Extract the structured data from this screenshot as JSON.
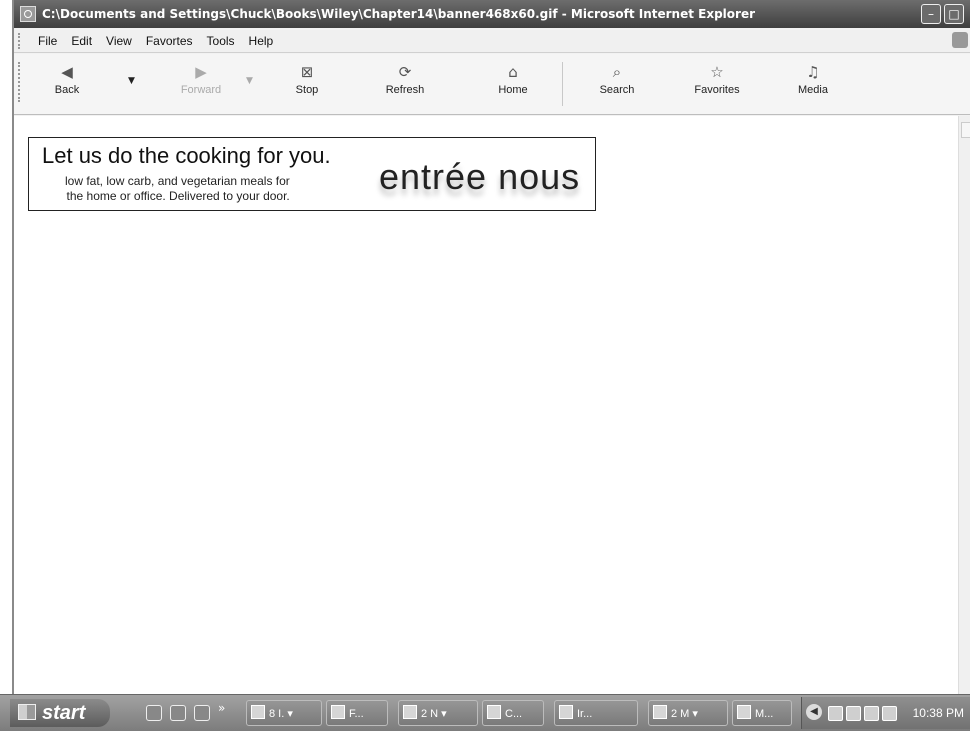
{
  "window": {
    "title": "C:\\Documents and Settings\\Chuck\\Books\\Wiley\\Chapter14\\banner468x60.gif - Microsoft Internet Explorer"
  },
  "menu": [
    "File",
    "Edit",
    "View",
    "Favortes",
    "Tools",
    "Help"
  ],
  "toolbar": {
    "back": "Back",
    "forward": "Forward",
    "stop": "Stop",
    "refresh": "Refresh",
    "home": "Home",
    "search": "Search",
    "favorites": "Favorites",
    "media": "Media"
  },
  "icons": {
    "back": "back-arrow-icon",
    "forward": "forward-arrow-icon",
    "stop": "stop-icon",
    "refresh": "refresh-icon",
    "home": "home-icon",
    "search": "search-icon",
    "favorites": "star-icon",
    "media": "media-icon"
  },
  "banner": {
    "headline": "Let us do the cooking for you.",
    "subtext": "low fat, low carb, and vegetarian meals for\nthe home or office. Delivered to your door.",
    "brand": "entrée nous"
  },
  "taskbar": {
    "start": "start",
    "quicklaunch_more": "»",
    "tasks": [
      "8 I.",
      "F...",
      "2 N",
      "C...",
      "Ir...",
      "2 M",
      "M..."
    ],
    "clock": "10:38 PM"
  }
}
